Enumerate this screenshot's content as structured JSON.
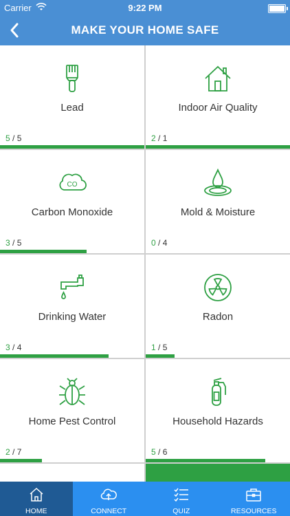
{
  "status": {
    "carrier": "Carrier",
    "time": "9:22 PM"
  },
  "header": {
    "title": "MAKE YOUR HOME SAFE",
    "back_icon": "chevron-left-icon"
  },
  "categories": [
    {
      "label": "Lead",
      "done": "5",
      "total": "5",
      "progress": 1.0,
      "icon": "paintbrush-icon"
    },
    {
      "label": "Indoor Air Quality",
      "done": "2",
      "total": "1",
      "progress": 1.0,
      "icon": "house-icon"
    },
    {
      "label": "Carbon Monoxide",
      "done": "3",
      "total": "5",
      "progress": 0.6,
      "icon": "co-cloud-icon"
    },
    {
      "label": "Mold & Moisture",
      "done": "0",
      "total": "4",
      "progress": 0.0,
      "icon": "water-drop-icon"
    },
    {
      "label": "Drinking Water",
      "done": "3",
      "total": "4",
      "progress": 0.75,
      "icon": "faucet-icon"
    },
    {
      "label": "Radon",
      "done": "1",
      "total": "5",
      "progress": 0.2,
      "icon": "radiation-icon"
    },
    {
      "label": "Home Pest Control",
      "done": "2",
      "total": "7",
      "progress": 0.29,
      "icon": "bug-icon"
    },
    {
      "label": "Household Hazards",
      "done": "5",
      "total": "6",
      "progress": 0.83,
      "icon": "fire-extinguisher-icon"
    }
  ],
  "score_separator": " / ",
  "tabs": [
    {
      "label": "HOME",
      "icon": "home-icon",
      "active": true
    },
    {
      "label": "CONNECT",
      "icon": "cloud-upload-icon",
      "active": false
    },
    {
      "label": "QUIZ",
      "icon": "checklist-icon",
      "active": false
    },
    {
      "label": "RESOURCES",
      "icon": "briefcase-icon",
      "active": false
    }
  ],
  "colors": {
    "brand": "#4a8fd4",
    "accent": "#2ea043",
    "tabbar": "#2b8ff0",
    "tab_active": "#1f5a94"
  }
}
